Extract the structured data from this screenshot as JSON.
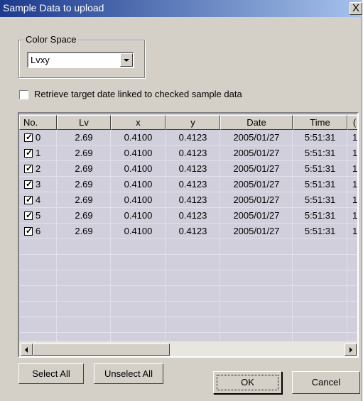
{
  "window": {
    "title": "Sample Data to upload",
    "close_glyph": "X"
  },
  "color_space": {
    "group_label": "Color Space",
    "selected": "Lvxy"
  },
  "retrieve": {
    "label": "Retrieve target date linked to checked sample data",
    "checked": false
  },
  "table": {
    "headers": [
      "No.",
      "Lv",
      "x",
      "y",
      "Date",
      "Time",
      "("
    ],
    "rows": [
      {
        "no": "0",
        "checked": true,
        "lv": "2.69",
        "x": "0.4100",
        "y": "0.4123",
        "date": "2005/01/27",
        "time": "5:51:31",
        "extra": "1"
      },
      {
        "no": "1",
        "checked": true,
        "lv": "2.69",
        "x": "0.4100",
        "y": "0.4123",
        "date": "2005/01/27",
        "time": "5:51:31",
        "extra": "1"
      },
      {
        "no": "2",
        "checked": true,
        "lv": "2.69",
        "x": "0.4100",
        "y": "0.4123",
        "date": "2005/01/27",
        "time": "5:51:31",
        "extra": "1"
      },
      {
        "no": "3",
        "checked": true,
        "lv": "2.69",
        "x": "0.4100",
        "y": "0.4123",
        "date": "2005/01/27",
        "time": "5:51:31",
        "extra": "1"
      },
      {
        "no": "4",
        "checked": true,
        "lv": "2.69",
        "x": "0.4100",
        "y": "0.4123",
        "date": "2005/01/27",
        "time": "5:51:31",
        "extra": "1"
      },
      {
        "no": "5",
        "checked": true,
        "lv": "2.69",
        "x": "0.4100",
        "y": "0.4123",
        "date": "2005/01/27",
        "time": "5:51:31",
        "extra": "1"
      },
      {
        "no": "6",
        "checked": true,
        "lv": "2.69",
        "x": "0.4100",
        "y": "0.4123",
        "date": "2005/01/27",
        "time": "5:51:31",
        "extra": "1"
      }
    ],
    "check_glyph": "✓"
  },
  "buttons": {
    "select_all": "Select All",
    "unselect_all": "Unselect All",
    "ok": "OK",
    "cancel": "Cancel"
  },
  "colors": {
    "title_gradient_start": "#1c3a8c",
    "title_gradient_end": "#a6c2ec",
    "dialog_face": "#d4d0c8",
    "list_background": "#d0cfdb"
  }
}
